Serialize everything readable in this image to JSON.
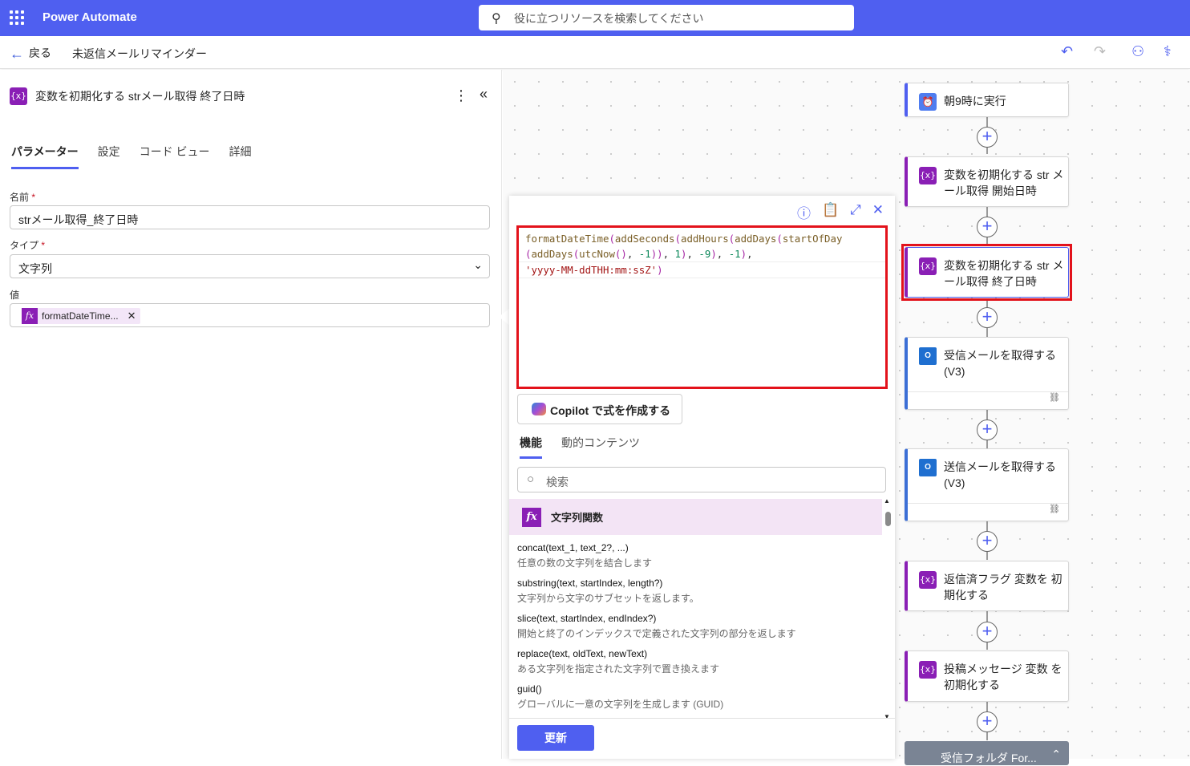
{
  "topbar": {
    "app": "Power Automate",
    "search_placeholder": "役に立つリソースを検索してください"
  },
  "subbar": {
    "back": "戻る",
    "flow_name": "未返信メールリマインダー"
  },
  "panel": {
    "title": "変数を初期化する strメール取得 終了日時",
    "badge": "{x}",
    "tabs": [
      "パラメーター",
      "設定",
      "コード ビュー",
      "詳細"
    ],
    "name_label": "名前",
    "name_value": "strメール取得_終了日時",
    "type_label": "タイプ",
    "type_value": "文字列",
    "value_label": "値",
    "token": "formatDateTime...",
    "required": "*"
  },
  "expression": {
    "line1_fn": "formatDateTime",
    "l1b": "addSeconds",
    "l1c": "addHours",
    "l1d": "addDays",
    "l1e": "startOfDay",
    "l2a": "addDays",
    "l2b": "utcNow",
    "n1": "-1",
    "n2": "1",
    "n3": "-9",
    "n4": "-1",
    "format": "'yyyy-MM-ddTHH:mm:ssZ'"
  },
  "popup": {
    "copilot": "Copilot で式を作成する",
    "tabs": [
      "機能",
      "動的コンテンツ"
    ],
    "search_placeholder": "検索",
    "category": "文字列関数",
    "update": "更新",
    "functions": [
      {
        "sig": "concat(text_1, text_2?, ...)",
        "desc": "任意の数の文字列を結合します"
      },
      {
        "sig": "substring(text, startIndex, length?)",
        "desc": "文字列から文字のサブセットを返します。"
      },
      {
        "sig": "slice(text, startIndex, endIndex?)",
        "desc": "開始と終了のインデックスで定義された文字列の部分を返します"
      },
      {
        "sig": "replace(text, oldText, newText)",
        "desc": "ある文字列を指定された文字列で置き換えます"
      },
      {
        "sig": "guid()",
        "desc": "グローバルに一意の文字列を生成します (GUID)"
      }
    ]
  },
  "flow": [
    {
      "title": "朝9時に実行"
    },
    {
      "title": "変数を初期化する str メール取得 開始日時"
    },
    {
      "title": "変数を初期化する str メール取得 終了日時"
    },
    {
      "title": "受信メールを取得する (V3)"
    },
    {
      "title": "送信メールを取得する (V3)"
    },
    {
      "title": "返信済フラグ 変数を 初期化する"
    },
    {
      "title": "投稿メッセージ 変数 を初期化する"
    },
    {
      "title": "受信フォルダ For..."
    }
  ]
}
